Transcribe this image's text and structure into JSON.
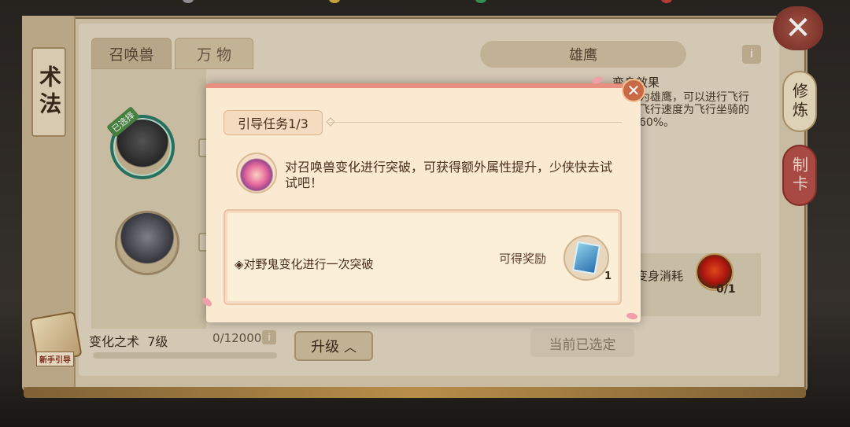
{
  "sidebar": {
    "vertical_tab": "术法",
    "guide_label": "新手引导"
  },
  "tabs": [
    {
      "label": "召唤兽"
    },
    {
      "label": "万 物"
    }
  ],
  "pets": [
    {
      "badge": "已选择"
    },
    {
      "badge": ""
    }
  ],
  "detail": {
    "name": "雄鹰",
    "info_icon": "i",
    "effect_title": "变身效果",
    "effect_text": "为雄鹰，可以进行飞行飞行速度为飞行坐骑的60%。",
    "cost_label": "变身消耗",
    "cost_count": "0/1"
  },
  "skill": {
    "name": "变化之术",
    "level": "7级",
    "exp": "0/12000",
    "exp_progress": 0,
    "upgrade_label": "升级",
    "selected_label": "当前已选定"
  },
  "right_tabs": [
    {
      "label": "修炼"
    },
    {
      "label": "制卡"
    }
  ],
  "close_glyph": "✕",
  "modal": {
    "close_glyph": "✕",
    "title": "引导任务1/3",
    "npc_text": "对召唤兽变化进行突破，可获得额外属性提升，少侠快去试试吧！",
    "objective": "◈对野鬼变化进行一次突破",
    "reward_label": "可得奖励",
    "reward_count": "1"
  },
  "colors": {
    "modal_bg": "#fbead2",
    "modal_accent": "#e88f80",
    "selected_ring": "#2b7a66"
  }
}
